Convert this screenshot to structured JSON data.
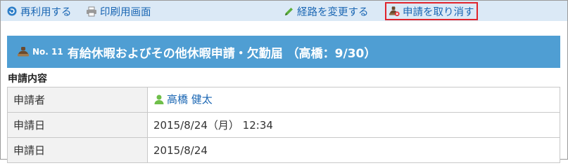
{
  "colors": {
    "toolbar_bg": "#dbe9f6",
    "link": "#1a66b3",
    "title_bg": "#4f9ed3",
    "highlight_border": "#e0242c",
    "label_bg": "#f2f2f2"
  },
  "toolbar": {
    "reuse": {
      "label": "再利用する",
      "icon": "reuse-icon"
    },
    "print": {
      "label": "印刷用画面",
      "icon": "printer-icon"
    },
    "change_route": {
      "label": "経路を変更する",
      "icon": "pencil-icon"
    },
    "cancel_request": {
      "label": "申請を取り消す",
      "icon": "cancel-request-icon"
    }
  },
  "title": {
    "icon": "request-stamp-icon",
    "number": "No. 11",
    "text": "有給休暇およびその他休暇申請・欠勤届 （高橋：9/30）"
  },
  "section_heading": "申請内容",
  "details": {
    "applicant": {
      "label": "申請者",
      "value": "高橋 健太",
      "icon": "user-icon"
    },
    "request_date": {
      "label": "申請日",
      "value": "2015/8/24（月） 12:34"
    },
    "application_date": {
      "label": "申請日",
      "value": "2015/8/24"
    }
  }
}
